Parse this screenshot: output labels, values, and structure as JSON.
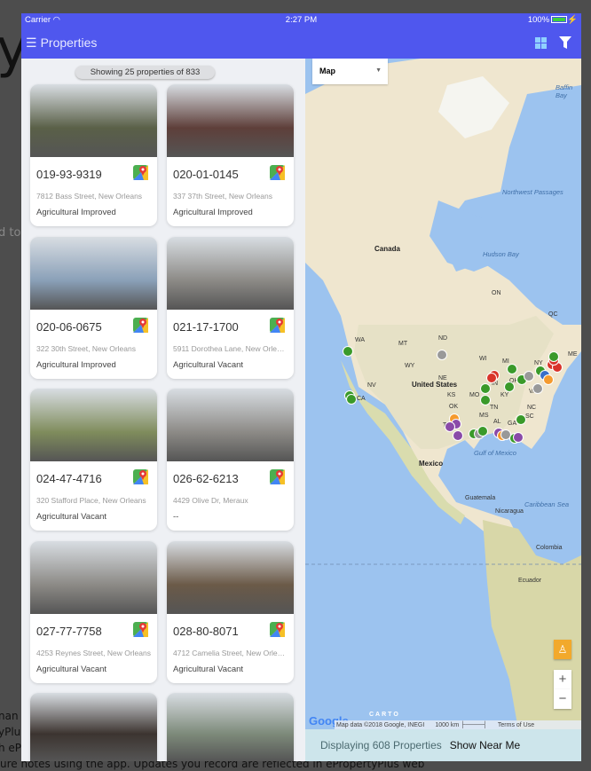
{
  "background_page": {
    "text_fragments": [
      "yP",
      "d to",
      "nan",
      "yPlu",
      "h eP",
      "ure notes using the app. Updates you record are reflected in ePropertyPlus web"
    ]
  },
  "status_bar": {
    "carrier": "Carrier",
    "time": "2:27 PM",
    "battery": "100%"
  },
  "nav": {
    "title": "Properties",
    "icons": [
      "menu-icon",
      "grid-icon",
      "filter-icon"
    ]
  },
  "list": {
    "summary": "Showing 25 properties of 833",
    "cards": [
      {
        "id": "019-93-9319",
        "address": "7812 Bass Street, New Orleans",
        "type": "Agricultural Improved",
        "img": "#5a6048"
      },
      {
        "id": "020-01-0145",
        "address": "337 37th Street, New Orleans",
        "type": "Agricultural Improved",
        "img": "#5e3f3a"
      },
      {
        "id": "020-06-0675",
        "address": "322 30th Street, New Orleans",
        "type": "Agricultural Improved",
        "img": "#8aa0b8"
      },
      {
        "id": "021-17-1700",
        "address": "5911 Dorothea Lane, New Orleans",
        "type": "Agricultural Vacant",
        "img": "#8c8a86"
      },
      {
        "id": "024-47-4716",
        "address": "320 Stafford Place, New Orleans",
        "type": "Agricultural Vacant",
        "img": "#7f8c5c"
      },
      {
        "id": "026-62-6213",
        "address": "4429 Olive Dr, Meraux",
        "type": "--",
        "img": "#8c8a86"
      },
      {
        "id": "027-77-7758",
        "address": "4253 Reynes Street, New Orleans",
        "type": "Agricultural Vacant",
        "img": "#8c8a86"
      },
      {
        "id": "028-80-8071",
        "address": "4712 Camelia Street, New Orleans",
        "type": "Agricultural Vacant",
        "img": "#6b5a48"
      },
      {
        "id": "",
        "address": "",
        "type": "",
        "img": "#3c3430"
      },
      {
        "id": "",
        "address": "",
        "type": "",
        "img": "#7d8a7a"
      }
    ]
  },
  "map": {
    "type_select": "Map",
    "labels": {
      "canada": "Canada",
      "us": "United States",
      "mexico": "Mexico",
      "hudson": "Hudson Bay",
      "baffin": "Baffin Bay",
      "nw": "Northwest Passages",
      "gulf": "Gulf of Mexico",
      "carib": "Caribbean Sea",
      "guat": "Guatemala",
      "nica": "Nicaragua",
      "colombia": "Colombia",
      "ecuador": "Ecuador",
      "on": "ON",
      "qc": "QC",
      "wa": "WA",
      "mt": "MT",
      "nd": "ND",
      "wy": "WY",
      "nv": "NV",
      "ca": "CA",
      "ks": "KS",
      "mo": "MO",
      "ok": "OK",
      "tx": "TX",
      "mi": "MI",
      "in": "IN",
      "oh": "OH",
      "ky": "KY",
      "va": "VA",
      "nc": "NC",
      "ga": "GA",
      "al": "AL",
      "ms": "MS",
      "sc": "SC",
      "tn": "TN",
      "wi": "WI",
      "ny": "NY",
      "me": "ME",
      "ne": "NE"
    },
    "zoom_in": "+",
    "zoom_out": "−",
    "attribution": "Map data ©2018 Google, INEGI",
    "scale": "1000 km",
    "terms": "Terms of Use",
    "carto": "CARTO",
    "google": "Google",
    "marker_colors": {
      "green": "#3a9a2a",
      "gray": "#999999",
      "red": "#d9332a",
      "orange": "#f59a2e",
      "purple": "#8a4aa8",
      "blue": "#3a6fc8"
    }
  },
  "footer": {
    "displaying": "Displaying 608 Properties",
    "show_near_me": "Show Near Me"
  }
}
